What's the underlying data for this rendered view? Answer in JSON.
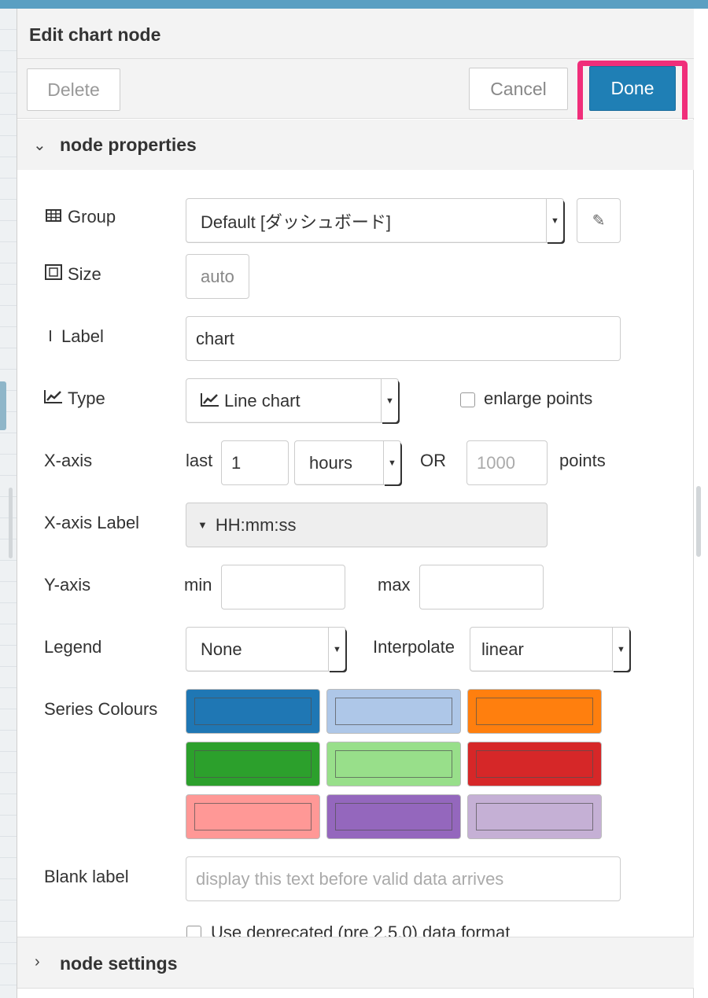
{
  "tray": {
    "title": "Edit chart node",
    "delete_label": "Delete",
    "cancel_label": "Cancel",
    "done_label": "Done"
  },
  "sections": {
    "properties_label": "node properties",
    "settings_label": "node settings"
  },
  "form": {
    "group": {
      "label": "Group",
      "value": "Default [ダッシュボード]",
      "icon": "table-icon"
    },
    "size": {
      "label": "Size",
      "value": "auto",
      "icon": "resize-icon"
    },
    "label": {
      "label": "Label",
      "value": "chart",
      "icon": "text-cursor-icon"
    },
    "type": {
      "label": "Type",
      "value": "Line chart",
      "icon": "line-chart-icon",
      "enlarge_label": "enlarge points",
      "enlarge_checked": false
    },
    "xaxis": {
      "label": "X-axis",
      "last_label": "last",
      "last_value": "1",
      "unit_value": "hours",
      "or_label": "OR",
      "points_placeholder": "1000",
      "points_label": "points"
    },
    "xaxis_label": {
      "label": "X-axis Label",
      "value": "HH:mm:ss"
    },
    "yaxis": {
      "label": "Y-axis",
      "min_label": "min",
      "min_value": "",
      "max_label": "max",
      "max_value": ""
    },
    "legend": {
      "label": "Legend",
      "value": "None",
      "interpolate_label": "Interpolate",
      "interpolate_value": "linear"
    },
    "series_colours": {
      "label": "Series Colours",
      "colors": [
        "#1f77b4",
        "#aec7e8",
        "#ff7f0e",
        "#2ca02c",
        "#98df8a",
        "#d62728",
        "#ff9896",
        "#9467bd",
        "#c5b0d5"
      ]
    },
    "blank_label": {
      "label": "Blank label",
      "placeholder": "display this text before valid data arrives"
    },
    "deprecated": {
      "label": "Use deprecated (pre 2.5.0) data format",
      "checked": false
    }
  },
  "colors": {
    "accent": "#1f7fb5",
    "highlight": "#f02e7a"
  }
}
